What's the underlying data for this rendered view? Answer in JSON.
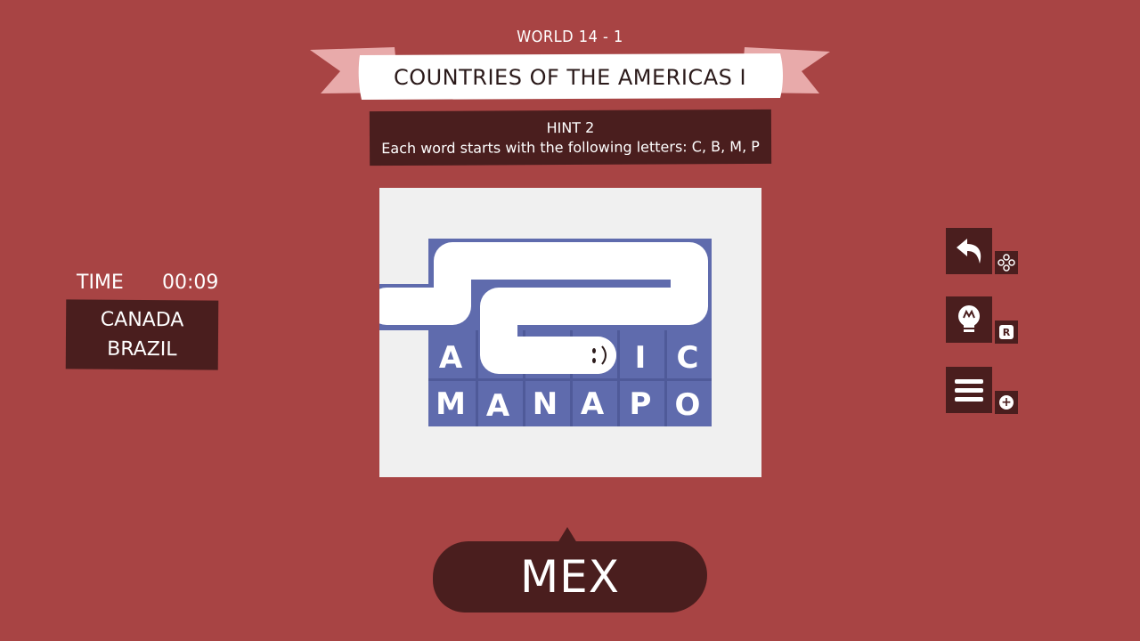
{
  "level": {
    "world_label": "WORLD 14 - 1",
    "title": "COUNTRIES OF THE AMERICAS I"
  },
  "hint": {
    "title": "HINT 2",
    "text": "Each word starts with the following letters: C, B, M, P"
  },
  "timer": {
    "label": "TIME",
    "value": "00:09"
  },
  "found_words": [
    "CANADA",
    "BRAZIL"
  ],
  "board": {
    "rows": [
      [
        "A",
        "",
        "",
        "",
        "I",
        "C"
      ],
      [
        "M",
        "A",
        "N",
        "A",
        "P",
        "O"
      ]
    ]
  },
  "controls": {
    "undo": {
      "icon": "undo-arrow-icon",
      "key_icon": "gamepad-buttons-icon"
    },
    "hint": {
      "icon": "lightbulb-icon",
      "key": "R"
    },
    "menu": {
      "icon": "menu-icon",
      "key": "+"
    }
  },
  "current_word": "MEX",
  "colors": {
    "background": "#a84444",
    "dark": "#4a1e1e",
    "board_bg": "#f0f0f0",
    "tile": "#5f6bad",
    "snake": "#ffffff"
  }
}
